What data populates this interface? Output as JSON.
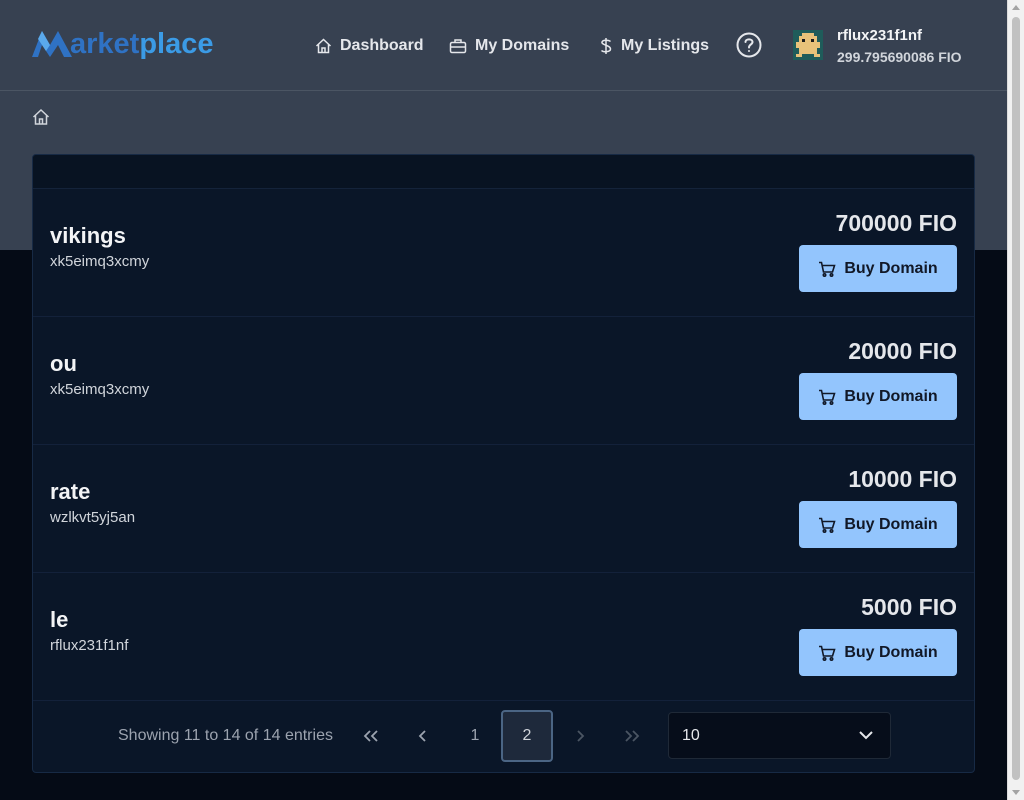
{
  "logo": {
    "text_a": "arket",
    "text_b": "place"
  },
  "nav": {
    "dashboard": "Dashboard",
    "my_domains": "My Domains",
    "my_listings": "My Listings"
  },
  "user": {
    "name": "rflux231f1nf",
    "balance": "299.795690086 FIO"
  },
  "listings": [
    {
      "domain": "vikings",
      "owner": "xk5eimq3xcmy",
      "price": "700000 FIO",
      "buy_label": "Buy Domain"
    },
    {
      "domain": "ou",
      "owner": "xk5eimq3xcmy",
      "price": "20000 FIO",
      "buy_label": "Buy Domain"
    },
    {
      "domain": "rate",
      "owner": "wzlkvt5yj5an",
      "price": "10000 FIO",
      "buy_label": "Buy Domain"
    },
    {
      "domain": "le",
      "owner": "rflux231f1nf",
      "price": "5000 FIO",
      "buy_label": "Buy Domain"
    }
  ],
  "pagination": {
    "info": "Showing 11 to 14 of 14 entries",
    "first": "«",
    "prev": "‹",
    "next": "›",
    "last": "»",
    "pages": [
      "1",
      "2"
    ],
    "current_page": "2",
    "page_size": "10"
  },
  "colors": {
    "accent": "#93c5fd",
    "header_bg": "#374151",
    "page_bg": "#050b16"
  }
}
